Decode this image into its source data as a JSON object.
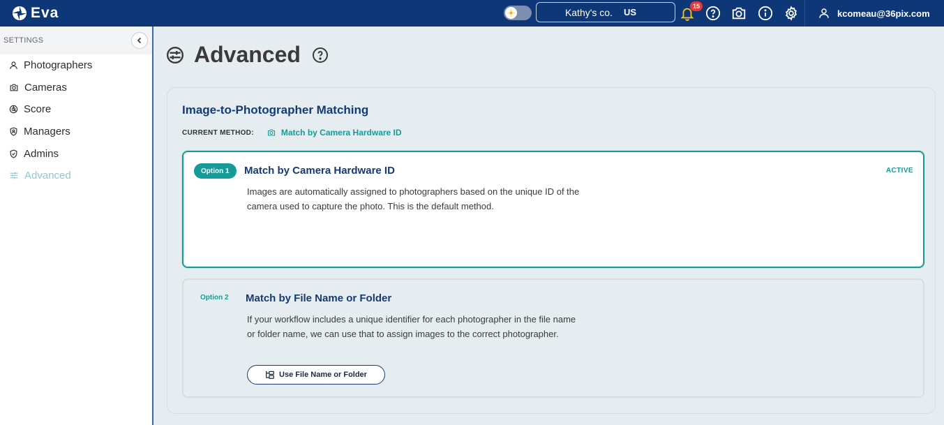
{
  "topbar": {
    "brand": "Eva",
    "org_name": "Kathy's co.",
    "org_region": "US",
    "notification_count": "15",
    "user_email": "kcomeau@36pix.com"
  },
  "sidebar": {
    "title": "SETTINGS",
    "items": [
      {
        "label": "Photographers",
        "icon": "person-icon"
      },
      {
        "label": "Cameras",
        "icon": "camera-icon"
      },
      {
        "label": "Score",
        "icon": "score-icon"
      },
      {
        "label": "Managers",
        "icon": "shield-icon"
      },
      {
        "label": "Admins",
        "icon": "shield-check-icon"
      },
      {
        "label": "Advanced",
        "icon": "sliders-icon",
        "active": true
      }
    ]
  },
  "page": {
    "title": "Advanced"
  },
  "matching": {
    "section_title": "Image-to-Photographer Matching",
    "current_method_label": "CURRENT METHOD:",
    "current_method_value": "Match by Camera Hardware ID",
    "options": [
      {
        "tag": "Option 1",
        "title": "Match by Camera Hardware ID",
        "status": "ACTIVE",
        "description": "Images are automatically assigned to photographers based on the unique ID of the camera used to capture the photo. This is the default method."
      },
      {
        "tag": "Option 2",
        "title": "Match by File Name or Folder",
        "description": "If your workflow includes a unique identifier for each photographer in the file name or folder name, we can use that to assign images to the correct photographer.",
        "button_label": "Use File Name or Folder"
      }
    ]
  },
  "colors": {
    "topbar": "#0e3778",
    "accent_teal": "#179b98",
    "title_navy": "#163a72",
    "badge_red": "#e23a3a"
  }
}
